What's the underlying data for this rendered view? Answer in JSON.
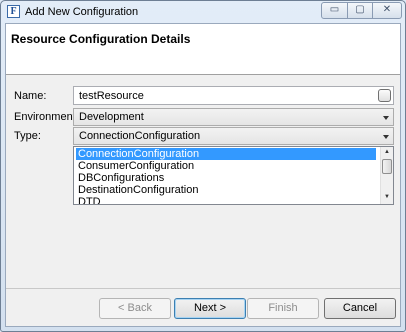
{
  "window": {
    "title": "Add New Configuration",
    "icon_letter": "F",
    "controls": {
      "minimize": "▭",
      "maximize": "▢",
      "close": "✕"
    }
  },
  "header": {
    "title": "Resource Configuration Details"
  },
  "form": {
    "name": {
      "label": "Name:",
      "value": "testResource"
    },
    "environment": {
      "label": "Environment:",
      "value": "Development"
    },
    "type": {
      "label": "Type:",
      "value": "ConnectionConfiguration",
      "options": [
        "ConnectionConfiguration",
        "ConsumerConfiguration",
        "DBConfigurations",
        "DestinationConfiguration",
        "DTD"
      ],
      "selected_index": 0
    }
  },
  "buttons": {
    "back": "< Back",
    "next": "Next >",
    "finish": "Finish",
    "cancel": "Cancel"
  },
  "scroll": {
    "up": "▲",
    "down": "▼"
  }
}
